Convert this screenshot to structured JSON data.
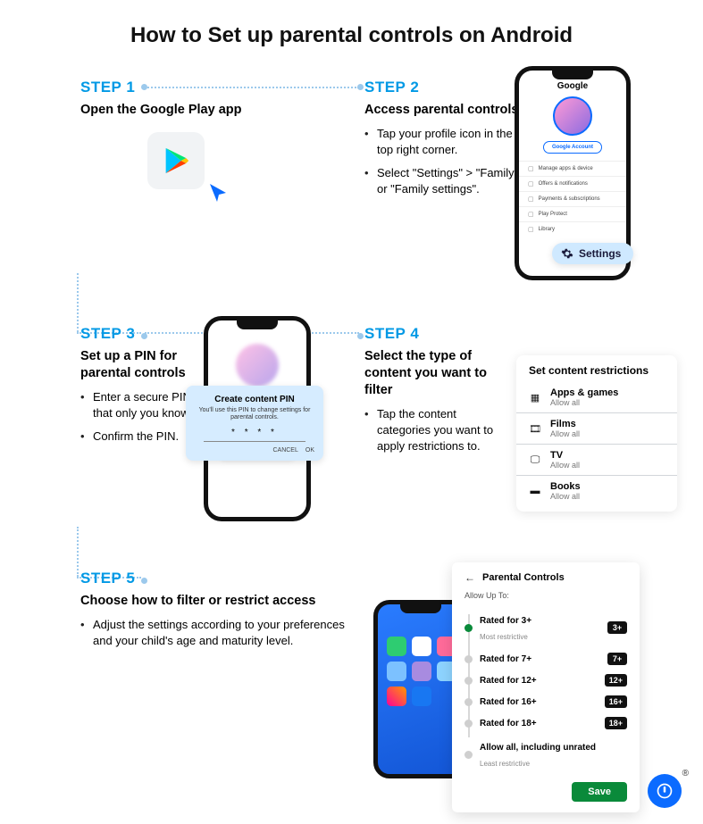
{
  "title": "How to Set up parental controls on Android",
  "step1": {
    "label": "STEP 1",
    "heading": "Open the Google Play app"
  },
  "step2": {
    "label": "STEP 2",
    "heading": "Access parental controls",
    "b1": "Tap your profile icon in the top right corner.",
    "b2": "Select \"Settings\" > \"Family\" or \"Family settings\".",
    "phone": {
      "google": "Google",
      "accountBtn": "Google Account",
      "r1": "Manage apps & device",
      "r2": "Offers & notifications",
      "r3": "Payments & subscriptions",
      "r4": "Play Protect",
      "r5": "Library"
    },
    "settingsPill": "Settings"
  },
  "step3": {
    "label": "STEP 3",
    "heading": "Set up a PIN for parental controls",
    "b1": "Enter a secure PIN that only you know.",
    "b2": "Confirm the PIN.",
    "pin": {
      "title": "Create content PIN",
      "sub": "You'll use this PIN to change settings for parental controls.",
      "stars": "* * * *",
      "cancel": "CANCEL",
      "ok": "OK"
    }
  },
  "step4": {
    "label": "STEP 4",
    "heading": "Select the type of content you want to filter",
    "b1": "Tap the content categories you want to apply restrictions to.",
    "card": {
      "title": "Set content restrictions",
      "r1n": "Apps & games",
      "r1s": "Allow all",
      "r2n": "Films",
      "r2s": "Allow all",
      "r3n": "TV",
      "r3s": "Allow all",
      "r4n": "Books",
      "r4s": "Allow all"
    }
  },
  "step5": {
    "label": "STEP 5",
    "heading": "Choose how to filter or restrict access",
    "b1": "Adjust the settings according to your preferences and your child's age and maturity level.",
    "pc": {
      "title": "Parental Controls",
      "allow": "Allow Up To:",
      "r1": "Rated for 3+",
      "r1s": "Most restrictive",
      "r1b": "3+",
      "r2": "Rated for 7+",
      "r2b": "7+",
      "r3": "Rated for 12+",
      "r3b": "12+",
      "r4": "Rated for 16+",
      "r4b": "16+",
      "r5": "Rated for 18+",
      "r5b": "18+",
      "r6": "Allow all, including unrated",
      "r6s": "Least restrictive",
      "save": "Save"
    }
  }
}
